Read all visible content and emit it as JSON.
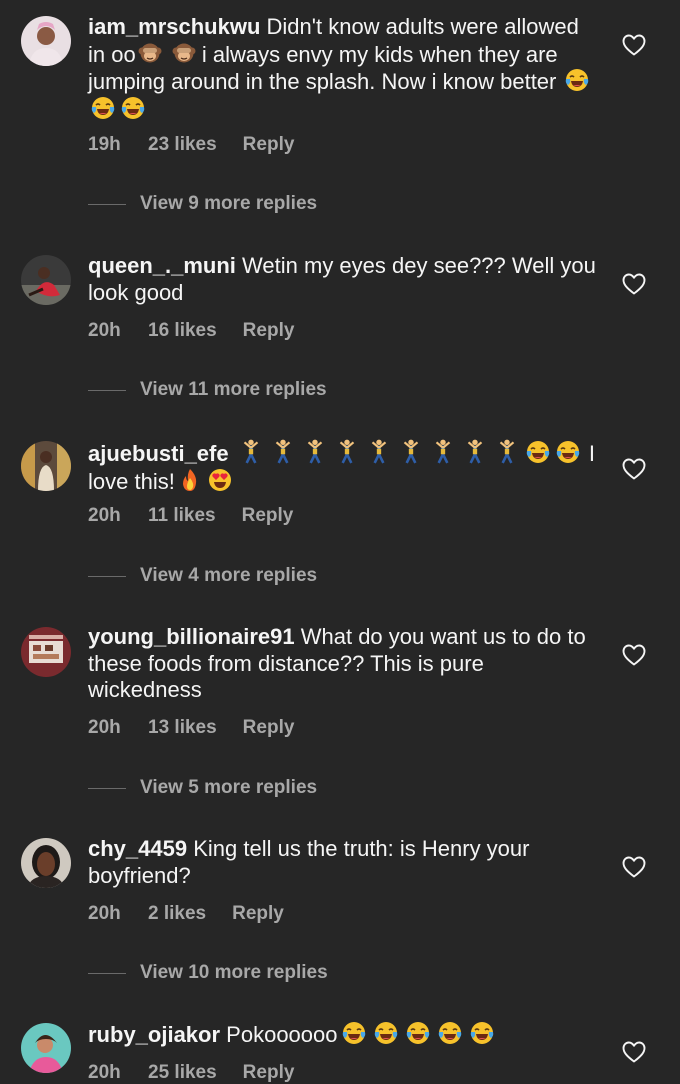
{
  "comments": [
    {
      "username": "iam_mrschukwu",
      "text_parts": [
        "Didn't know adults were allowed in oo",
        " i always envy my kids when they are jumping around in the splash. Now i know better "
      ],
      "time": "19h",
      "likes": "23 likes",
      "reply": "Reply",
      "view_more": "View 9 more replies"
    },
    {
      "username": "queen_._muni",
      "text_parts": [
        "Wetin my eyes dey see??? Well you look good"
      ],
      "time": "20h",
      "likes": "16 likes",
      "reply": "Reply",
      "view_more": "View 11 more replies"
    },
    {
      "username": "ajuebusti_efe",
      "text_parts": [
        "",
        " I love this!"
      ],
      "time": "20h",
      "likes": "11 likes",
      "reply": "Reply",
      "view_more": "View 4 more replies"
    },
    {
      "username": "young_billionaire91",
      "text_parts": [
        "What do you want us to do to these foods from distance?? This is pure wickedness"
      ],
      "time": "20h",
      "likes": "13 likes",
      "reply": "Reply",
      "view_more": "View 5 more replies"
    },
    {
      "username": "chy_4459",
      "text_parts": [
        "King tell us the truth: is Henry your boyfriend?"
      ],
      "time": "20h",
      "likes": "2 likes",
      "reply": "Reply",
      "view_more": "View 10 more replies"
    },
    {
      "username": "ruby_ojiakor",
      "text_parts": [
        "Pokoooooo"
      ],
      "time": "20h",
      "likes": "25 likes",
      "reply": "Reply"
    }
  ],
  "colors": {
    "background": "#262626",
    "text": "#f5f5f5",
    "secondary": "#a8a8a8"
  },
  "icons": {
    "like": "heart-outline-icon",
    "emoji_laugh": "face-with-tears-of-joy",
    "emoji_monkey": "see-no-evil-monkey",
    "emoji_dance": "person-cartwheeling",
    "emoji_fire": "fire",
    "emoji_heart_eyes": "smiling-face-with-heart-eyes"
  }
}
